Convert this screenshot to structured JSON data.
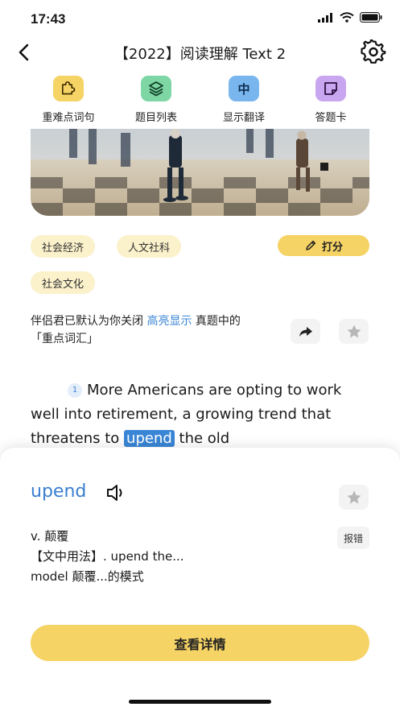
{
  "status": {
    "time": "17:43"
  },
  "nav": {
    "title": "【2022】阅读理解 Text 2"
  },
  "toolbar": {
    "items": [
      {
        "label": "重难点词句",
        "icon": "puzzle-icon",
        "color": "#f6d365"
      },
      {
        "label": "题目列表",
        "icon": "layers-icon",
        "color": "#7ed6a5"
      },
      {
        "label": "显示翻译",
        "icon_text": "中",
        "color": "#7ab6ee"
      },
      {
        "label": "答题卡",
        "icon": "note-icon",
        "color": "#c9a7f0"
      }
    ]
  },
  "tags": [
    "社会经济",
    "人文社科",
    "社会文化"
  ],
  "grade": {
    "label": "打分"
  },
  "notice": {
    "prefix": "伴侣君已默认为你关闭",
    "highlight": "高亮显示",
    "suffix": "真题中的「重点词汇」"
  },
  "article": {
    "paragraph_no": "1",
    "text_before": "More Americans are opting to work well into retirement, a growing trend that threatens to",
    "highlight_word": "upend",
    "text_after": "the old"
  },
  "sheet": {
    "word": "upend",
    "pos_meaning": "v. 颠覆",
    "usage_line1": "【文中用法】. upend the...",
    "usage_line2": "model 颠覆...的模式",
    "report_label": "报错",
    "detail_label": "查看详情"
  },
  "colors": {
    "accent_blue": "#3a86d6",
    "accent_yellow": "#f6d365",
    "tag_bg": "#fbf1cb"
  }
}
